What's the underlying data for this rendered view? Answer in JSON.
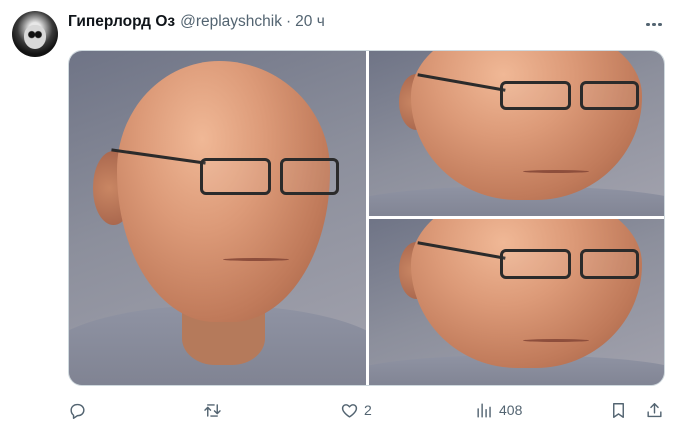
{
  "tweet": {
    "author_name": "Гиперлорд Оз",
    "author_handle": "@replayshchik",
    "separator": "·",
    "time": "20 ч"
  },
  "media": {
    "count": 3
  },
  "actions": {
    "replies": "",
    "retweets": "",
    "likes": "2",
    "views": "408"
  },
  "icons": {
    "more": "more-horizontal-icon",
    "reply": "reply-icon",
    "retweet": "retweet-icon",
    "like": "heart-icon",
    "views": "views-chart-icon",
    "bookmark": "bookmark-icon",
    "share": "share-icon"
  },
  "colors": {
    "text_primary": "#0f1419",
    "text_secondary": "#536471",
    "border": "#cfd9de"
  }
}
